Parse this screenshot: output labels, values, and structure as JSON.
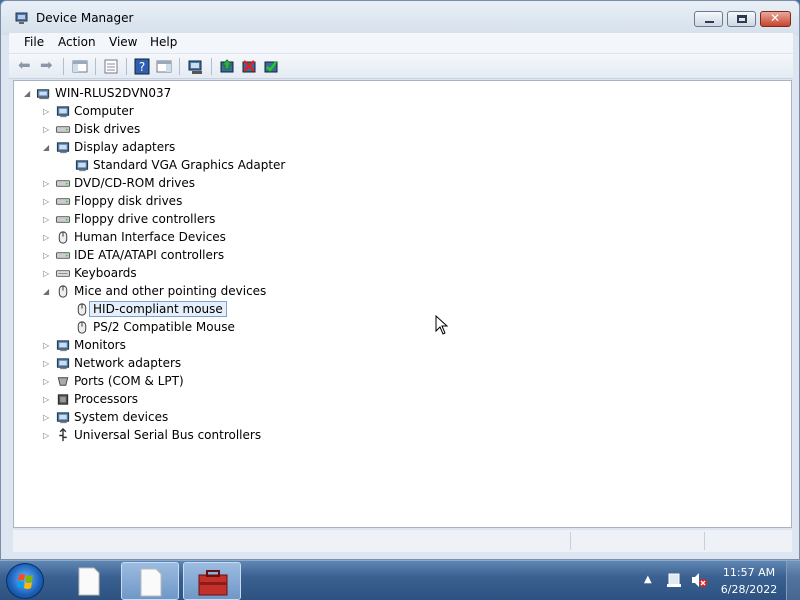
{
  "window": {
    "title": "Device Manager"
  },
  "menu": [
    "File",
    "Action",
    "View",
    "Help"
  ],
  "tree": {
    "root": "WIN-RLUS2DVN037",
    "items": [
      {
        "label": "Computer",
        "expanded": false,
        "icon": "computer-icon"
      },
      {
        "label": "Disk drives",
        "expanded": false,
        "icon": "disk-drive-icon"
      },
      {
        "label": "Display adapters",
        "expanded": true,
        "icon": "display-adapter-icon",
        "children": [
          "Standard VGA Graphics Adapter"
        ]
      },
      {
        "label": "DVD/CD-ROM drives",
        "expanded": false,
        "icon": "dvd-drive-icon"
      },
      {
        "label": "Floppy disk drives",
        "expanded": false,
        "icon": "floppy-disk-icon"
      },
      {
        "label": "Floppy drive controllers",
        "expanded": false,
        "icon": "floppy-controller-icon"
      },
      {
        "label": "Human Interface Devices",
        "expanded": false,
        "icon": "hid-icon"
      },
      {
        "label": "IDE ATA/ATAPI controllers",
        "expanded": false,
        "icon": "ide-controller-icon"
      },
      {
        "label": "Keyboards",
        "expanded": false,
        "icon": "keyboard-icon"
      },
      {
        "label": "Mice and other pointing devices",
        "expanded": true,
        "icon": "mouse-icon",
        "children": [
          "HID-compliant mouse",
          "PS/2 Compatible Mouse"
        ]
      },
      {
        "label": "Monitors",
        "expanded": false,
        "icon": "monitor-icon"
      },
      {
        "label": "Network adapters",
        "expanded": false,
        "icon": "network-adapter-icon"
      },
      {
        "label": "Ports (COM & LPT)",
        "expanded": false,
        "icon": "port-icon"
      },
      {
        "label": "Processors",
        "expanded": false,
        "icon": "processor-icon"
      },
      {
        "label": "System devices",
        "expanded": false,
        "icon": "system-device-icon"
      },
      {
        "label": "Universal Serial Bus controllers",
        "expanded": false,
        "icon": "usb-icon"
      }
    ],
    "selected": "HID-compliant mouse"
  },
  "taskbar": {
    "time": "11:57 AM",
    "date": "6/28/2022"
  }
}
